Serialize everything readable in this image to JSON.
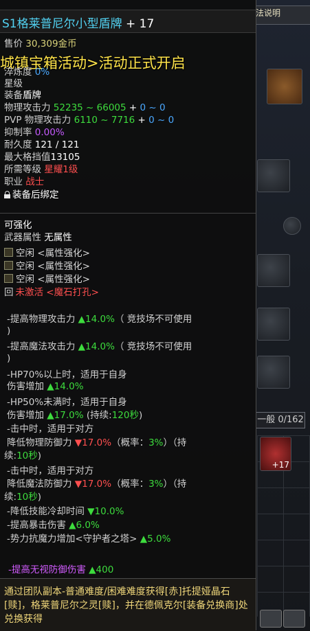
{
  "background": {
    "top_button": "法说明",
    "inventory_tab": "一般",
    "inventory_count": "0/162",
    "slot_badge": "+17"
  },
  "announcement": "城镇宝箱活动>活动正式开启",
  "item": {
    "name": "S1格莱普尼尔小型盾牌",
    "enhance": "+ 17",
    "price_label": "售价",
    "price_value": "30,309金币",
    "purity_label": "淬炼度",
    "purity_value": "0%",
    "star_label": "星级",
    "equip_label": "装备",
    "equip_value": "盾牌",
    "phys_atk_label": "物理攻击力",
    "phys_atk_range": "52235 ~ 66005",
    "phys_atk_bonus_plus": "+",
    "phys_atk_bonus": "0 ~ 0",
    "pvp_label": "PVP 物理攻击力",
    "pvp_range": "6110 ~ 7716",
    "pvp_bonus_plus": "+",
    "pvp_bonus": "0 ~ 0",
    "suppress_label": "抑制率",
    "suppress_value": "0.00%",
    "durability_label": "耐久度",
    "durability_value": "121 / 121",
    "block_label": "最大格挡值",
    "block_value": "13105",
    "level_label": "所需等级",
    "level_value": "星耀1级",
    "job_label": "职业",
    "job_value": "战士",
    "bind_text": "装备后绑定",
    "enhanceable": "可强化",
    "weapon_attr_label": "武器属性",
    "weapon_attr_value": "无属性",
    "sockets": [
      "空闲 <属性强化>",
      "空闲 <属性强化>",
      "空闲 <属性强化>"
    ],
    "gem_socket_icon": "回",
    "gem_socket": "未激活 <魔石打孔>",
    "effects": {
      "e1a": "-提高物理攻击力 ",
      "e1b": "▲14.0%",
      "e1c": "（ 竞技场不可使用",
      "e1d": ")",
      "e2a": "-提高魔法攻击力 ",
      "e2b": "▲14.0%",
      "e2c": "（ 竞技场不可使用",
      "e2d": ")",
      "e3a": "-HP70%以上时，适用于自身",
      "e3b": " 伤害增加 ",
      "e3c": "▲14.0%",
      "e4a": "-HP50%未满时，适用于自身",
      "e4b": " 伤害增加 ",
      "e4c": "▲17.0%",
      "e4d": " (持续:",
      "e4e": "120秒",
      "e4f": ")",
      "e5a": "-击中时，适用于对方",
      "e5b": " 降低物理防御力 ",
      "e5c": "▼17.0%",
      "e5d": "（概率：",
      "e5e": "3%",
      "e5f": "）（持",
      "e5g": "续:",
      "e5h": "10秒",
      "e5i": ")",
      "e6a": "-击中时，适用于对方",
      "e6b": " 降低魔法防御力 ",
      "e6c": "▼17.0%",
      "e6d": "（概率：",
      "e6e": "3%",
      "e6f": "）（持",
      "e6g": "续:",
      "e6h": "10秒",
      "e6i": ")",
      "e7a": "-降低技能冷却时间 ",
      "e7b": "▼10.0%",
      "e8a": "-提高暴击伤害 ",
      "e8b": "▲6.0%",
      "e9a": "-势力抗魔力增加<守护者之塔> ",
      "e9b": "▲5.0%"
    },
    "special_a": "-提高无视防御伤害 ",
    "special_b": "▲400",
    "source": "通过团队副本-普通难度/困难难度获得[赤]托提娅晶石[赎]，格莱普尼尔之灵[赎]，并在德佩克尔[装备兑换商]处兑换获得"
  },
  "colors": {
    "title": "#52d2f2",
    "announcement": "#ffe44a",
    "increase": "#3ddc3d",
    "decrease": "#ff4f4f",
    "special": "#c65bff",
    "source": "#efd67a"
  }
}
